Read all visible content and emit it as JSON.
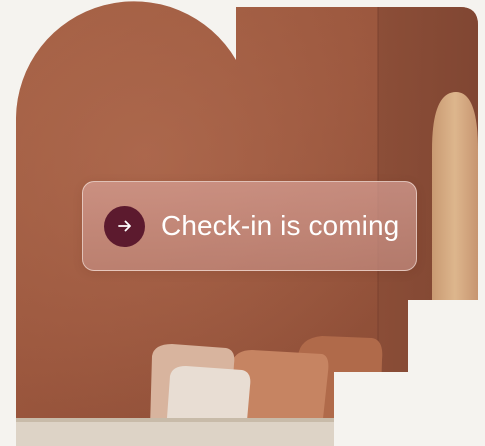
{
  "promo": {
    "label": "Check-in is coming",
    "icon": "arrow-right-icon",
    "accent_color": "#5c1a2e"
  }
}
